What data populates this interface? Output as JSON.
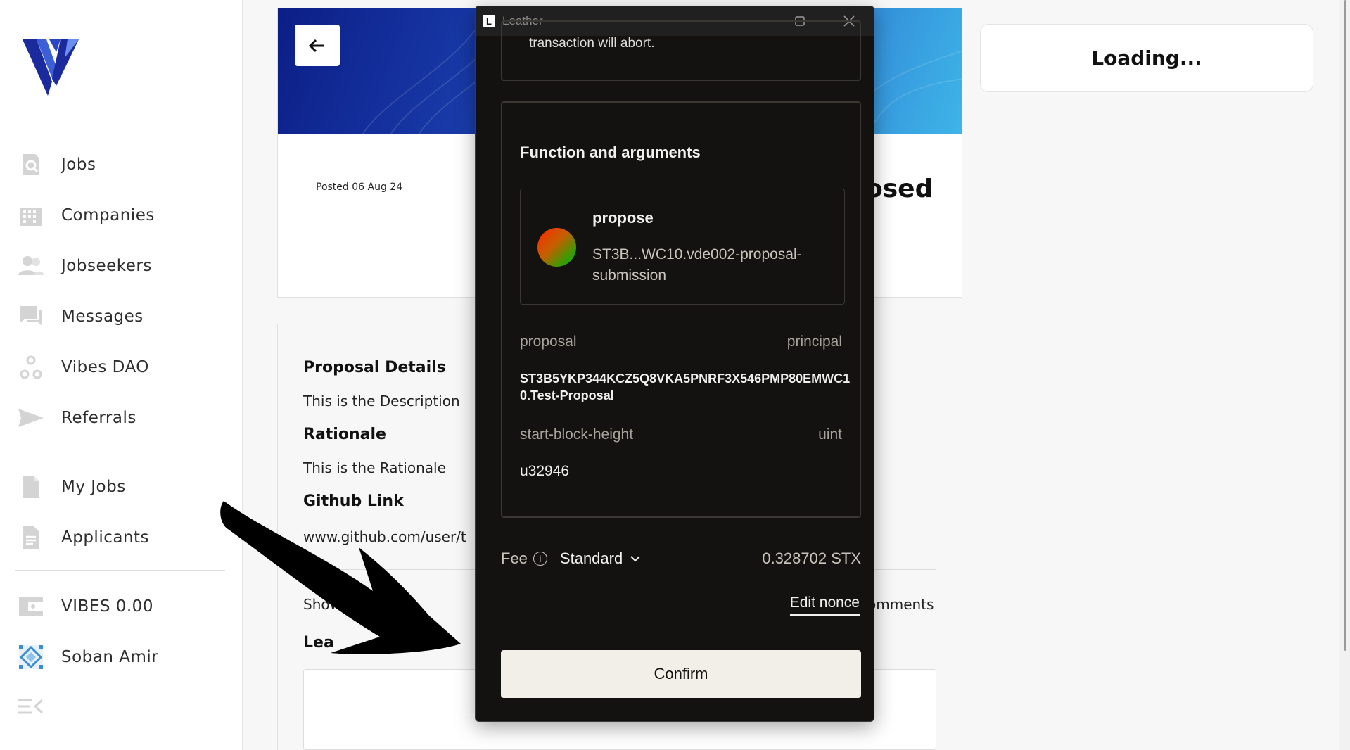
{
  "sidebar": {
    "items": [
      {
        "label": "Jobs",
        "icon": "search-document-icon"
      },
      {
        "label": "Companies",
        "icon": "building-icon"
      },
      {
        "label": "Jobseekers",
        "icon": "people-icon"
      },
      {
        "label": "Messages",
        "icon": "chat-icon"
      },
      {
        "label": "Vibes DAO",
        "icon": "nodes-icon"
      },
      {
        "label": "Referrals",
        "icon": "send-icon"
      },
      {
        "label": "My Jobs",
        "icon": "file-icon"
      },
      {
        "label": "Applicants",
        "icon": "document-icon"
      },
      {
        "label": "VIBES 0.00",
        "icon": "wallet-icon"
      },
      {
        "label": "Soban Amir",
        "icon": "avatar-icon"
      }
    ]
  },
  "job": {
    "posted": "Posted 06 Aug 24",
    "title_fragment": "osed"
  },
  "details": {
    "proposal_heading": "Proposal Details",
    "proposal_text": "This is the Description",
    "rationale_heading": "Rationale",
    "rationale_text": "This is the Rationale",
    "github_heading": "Github Link",
    "github_text": "www.github.com/user/t",
    "showing_text": "Showing",
    "comments_text": "omments",
    "leave_text": "Lea"
  },
  "right_panel": {
    "loading": "Loading..."
  },
  "popup": {
    "window_title": "Leather",
    "prev_box_text": "transaction will abort.",
    "section_title": "Function and arguments",
    "function_name": "propose",
    "contract": "ST3B...WC10.vde002-proposal-submission",
    "args": [
      {
        "name": "proposal",
        "type": "principal",
        "value": "ST3B5YKP344KCZ5Q8VKA5PNRF3X546PMP80EMWC10.Test-Proposal"
      },
      {
        "name": "start-block-height",
        "type": "uint",
        "value": "u32946"
      }
    ],
    "fee_label": "Fee",
    "fee_type": "Standard",
    "fee_amount": "0.328702 STX",
    "edit_nonce": "Edit nonce",
    "confirm": "Confirm"
  },
  "colors": {
    "popup_bg": "#141210",
    "confirm_bg": "#f2efe9",
    "logo_blue": "#1b2a9c"
  }
}
